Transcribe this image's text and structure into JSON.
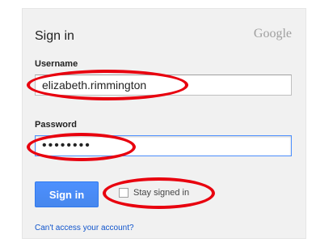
{
  "header": {
    "title": "Sign in",
    "logo": "Google"
  },
  "username": {
    "label": "Username",
    "value": "elizabeth.rimmington"
  },
  "password": {
    "label": "Password",
    "value": "••••••••"
  },
  "actions": {
    "sign_in_label": "Sign in",
    "stay_signed_in_label": "Stay signed in",
    "stay_signed_in_checked": false
  },
  "footer": {
    "link_text": "Can't access your account?"
  },
  "annotation_color": "#e8000e"
}
